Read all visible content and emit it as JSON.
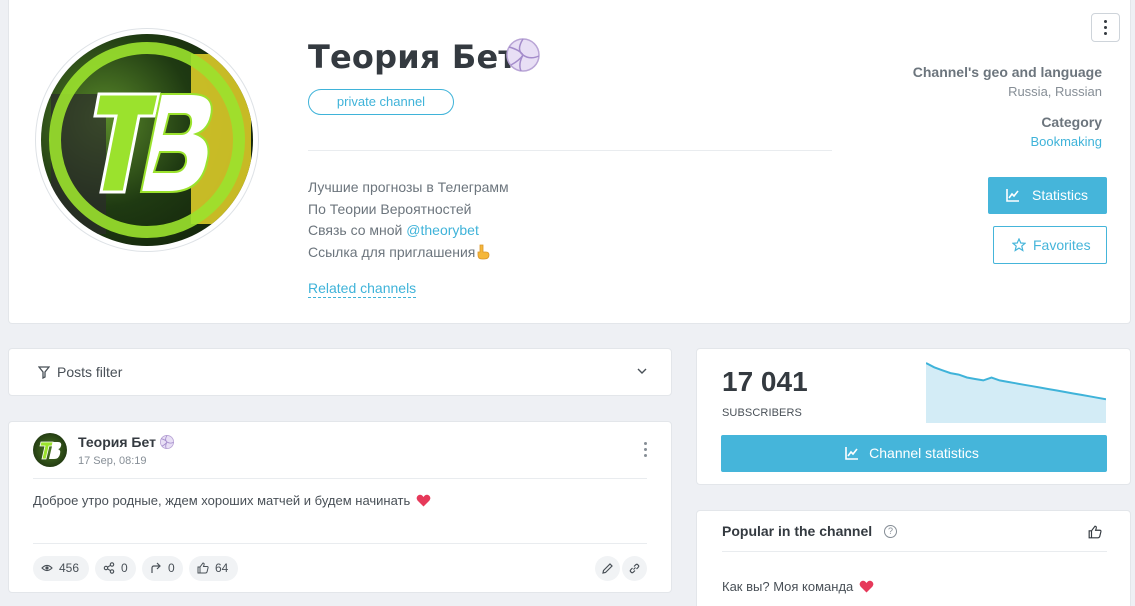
{
  "channel": {
    "title": "Теория Бет",
    "badge": "private channel",
    "description_lines": [
      "Лучшие прогнозы в Телеграмм",
      "По Теории Вероятностей"
    ],
    "contact_prefix": "Связь со мной",
    "contact_handle": "@theorybet",
    "invite_text": "Ссылка для приглашения",
    "related_label": "Related channels"
  },
  "meta": {
    "geo_heading": "Channel's geo and language",
    "geo_value": "Russia, Russian",
    "category_heading": "Category",
    "category_value": "Bookmaking"
  },
  "actions": {
    "statistics_label": "Statistics",
    "favorites_label": "Favorites"
  },
  "filter": {
    "label": "Posts filter"
  },
  "post": {
    "author": "Теория Бет",
    "date": "17 Sep, 08:19",
    "text": "Доброе утро родные, ждем хороших матчей и будем начинать",
    "views": "456",
    "shares": "0",
    "forwards": "0",
    "likes": "64"
  },
  "subscribers": {
    "count": "17 041",
    "label": "subscribers",
    "button_label": "Channel statistics",
    "trend_values": [
      100,
      97,
      95,
      93,
      92,
      90,
      89,
      88,
      90,
      88,
      87,
      86,
      85,
      84,
      83,
      82,
      81,
      80,
      79,
      78,
      77,
      76,
      75
    ]
  },
  "popular": {
    "title": "Popular in the channel",
    "help": "?",
    "first_item": "Как вы? Моя команда"
  },
  "colors": {
    "accent": "#45b5da",
    "heart": "#e6395a"
  }
}
